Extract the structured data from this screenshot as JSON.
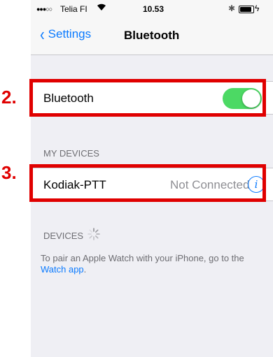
{
  "status_bar": {
    "signal": "●●●○○",
    "carrier": "Telia FI",
    "wifi_icon": "wifi-icon",
    "time": "10.53",
    "bluetooth_icon": "bluetooth-icon",
    "battery_level": 0.9,
    "charging_icon": "bolt-icon"
  },
  "nav": {
    "back_label": "Settings",
    "back_icon": "chevron-left-icon",
    "title": "Bluetooth"
  },
  "bluetooth_row": {
    "label": "Bluetooth",
    "toggle_on": true,
    "toggle_color": "#4cd964"
  },
  "my_devices": {
    "header": "MY DEVICES",
    "devices": [
      {
        "name": "Kodiak-PTT",
        "status": "Not Connected",
        "info_icon": "i"
      }
    ]
  },
  "devices": {
    "header": "DEVICES",
    "searching": true
  },
  "footnote": {
    "text": "To pair an Apple Watch with your iPhone, go to the ",
    "link": "Watch app",
    "after": "."
  },
  "annotations": {
    "step2": "2.",
    "step3": "3.",
    "color": "#e00000"
  },
  "accent": "#0a7aff"
}
